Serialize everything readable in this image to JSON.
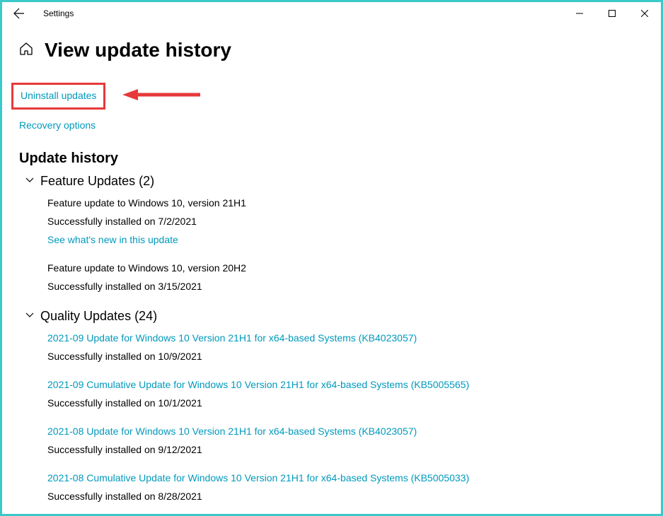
{
  "app_title": "Settings",
  "page_title": "View update history",
  "links": {
    "uninstall": "Uninstall updates",
    "recovery": "Recovery options"
  },
  "section_title": "Update history",
  "feature_group_title": "Feature Updates (2)",
  "quality_group_title": "Quality Updates (24)",
  "feature_updates": [
    {
      "name": "Feature update to Windows 10, version 21H1",
      "status": "Successfully installed on 7/2/2021",
      "link": "See what's new in this update"
    },
    {
      "name": "Feature update to Windows 10, version 20H2",
      "status": "Successfully installed on 3/15/2021"
    }
  ],
  "quality_updates": [
    {
      "name": "2021-09 Update for Windows 10 Version 21H1 for x64-based Systems (KB4023057)",
      "status": "Successfully installed on 10/9/2021"
    },
    {
      "name": "2021-09 Cumulative Update for Windows 10 Version 21H1 for x64-based Systems (KB5005565)",
      "status": "Successfully installed on 10/1/2021"
    },
    {
      "name": "2021-08 Update for Windows 10 Version 21H1 for x64-based Systems (KB4023057)",
      "status": "Successfully installed on 9/12/2021"
    },
    {
      "name": "2021-08 Cumulative Update for Windows 10 Version 21H1 for x64-based Systems (KB5005033)",
      "status": "Successfully installed on 8/28/2021"
    }
  ]
}
